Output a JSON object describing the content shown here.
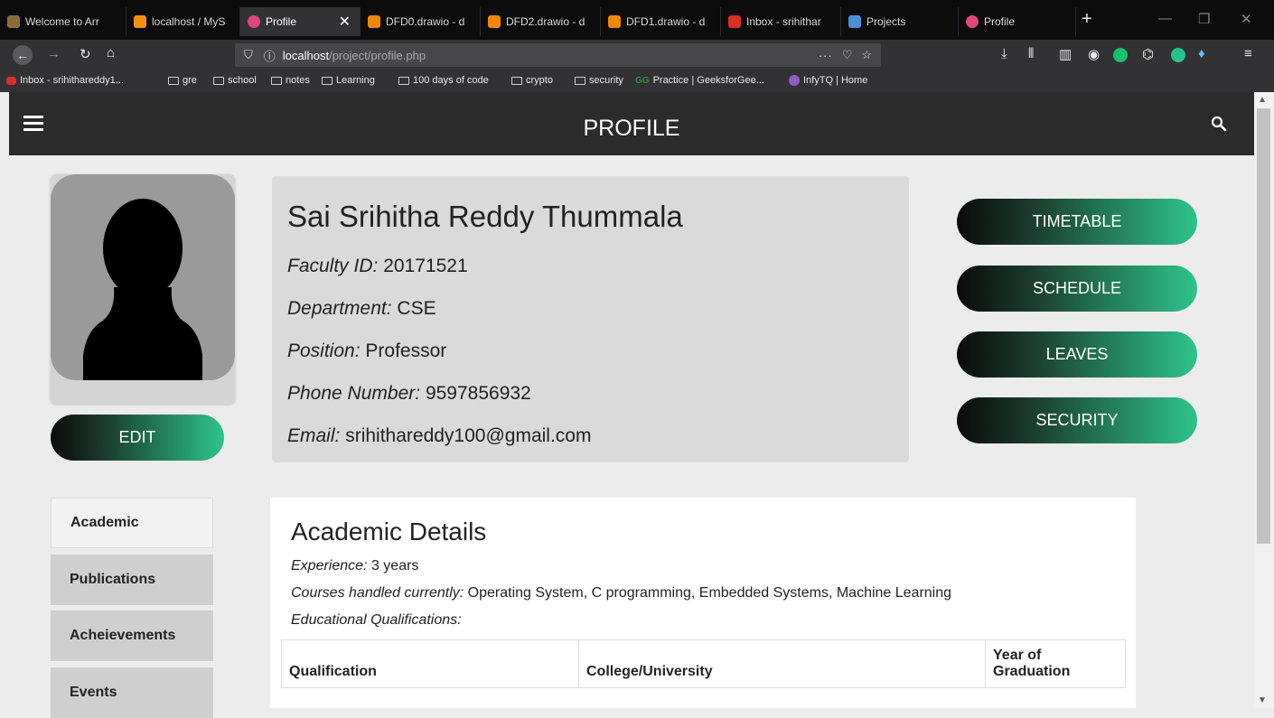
{
  "browser": {
    "tabs": [
      {
        "label": "Welcome to Arr",
        "color": "#8a6d3b"
      },
      {
        "label": "localhost / MyS",
        "color": "#f29111"
      },
      {
        "label": "Profile",
        "color": "#e0457b"
      },
      {
        "label": "DFD0.drawio - d",
        "color": "#f08705"
      },
      {
        "label": "DFD2.drawio - d",
        "color": "#f08705"
      },
      {
        "label": "DFD1.drawio - d",
        "color": "#f08705"
      },
      {
        "label": "Inbox - srihithar",
        "color": "#d93025"
      },
      {
        "label": "Projects",
        "color": "#4a90d9"
      },
      {
        "label": "Profile",
        "color": "#e0457b"
      }
    ],
    "url_host": "localhost",
    "url_path": "/project/profile.php",
    "bookmarks": [
      "Inbox - srihithareddy1...",
      "gre",
      "school",
      "notes",
      "Learning",
      "100 days of code",
      "crypto",
      "security",
      "Practice | GeeksforGee...",
      "InfyTQ | Home"
    ]
  },
  "header": {
    "title": "PROFILE"
  },
  "profile": {
    "name": "Sai Srihitha Reddy Thummala",
    "fields": [
      {
        "label": "Faculty ID:",
        "value": "20171521"
      },
      {
        "label": "Department:",
        "value": "CSE"
      },
      {
        "label": "Position:",
        "value": "Professor"
      },
      {
        "label": "Phone Number:",
        "value": "9597856932"
      },
      {
        "label": "Email:",
        "value": "srihithareddy100@gmail.com"
      }
    ],
    "edit_label": "EDIT"
  },
  "actions": [
    "TIMETABLE",
    "SCHEDULE",
    "LEAVES",
    "SECURITY"
  ],
  "sidebar": [
    "Academic",
    "Publications",
    "Acheievements",
    "Events"
  ],
  "details": {
    "title": "Academic Details",
    "experience_label": "Experience:",
    "experience_value": "3 years",
    "courses_label": "Courses handled currently:",
    "courses_value": "Operating System, C programming, Embedded Systems, Machine Learning",
    "qual_label": "Educational Qualifications:",
    "table_headers": [
      "Qualification",
      "College/University",
      "Year of Graduation"
    ]
  },
  "colors": {
    "accent_start": "#0a0a0a",
    "accent_end": "#2ec48c",
    "header_bg": "#2b2b2b"
  }
}
